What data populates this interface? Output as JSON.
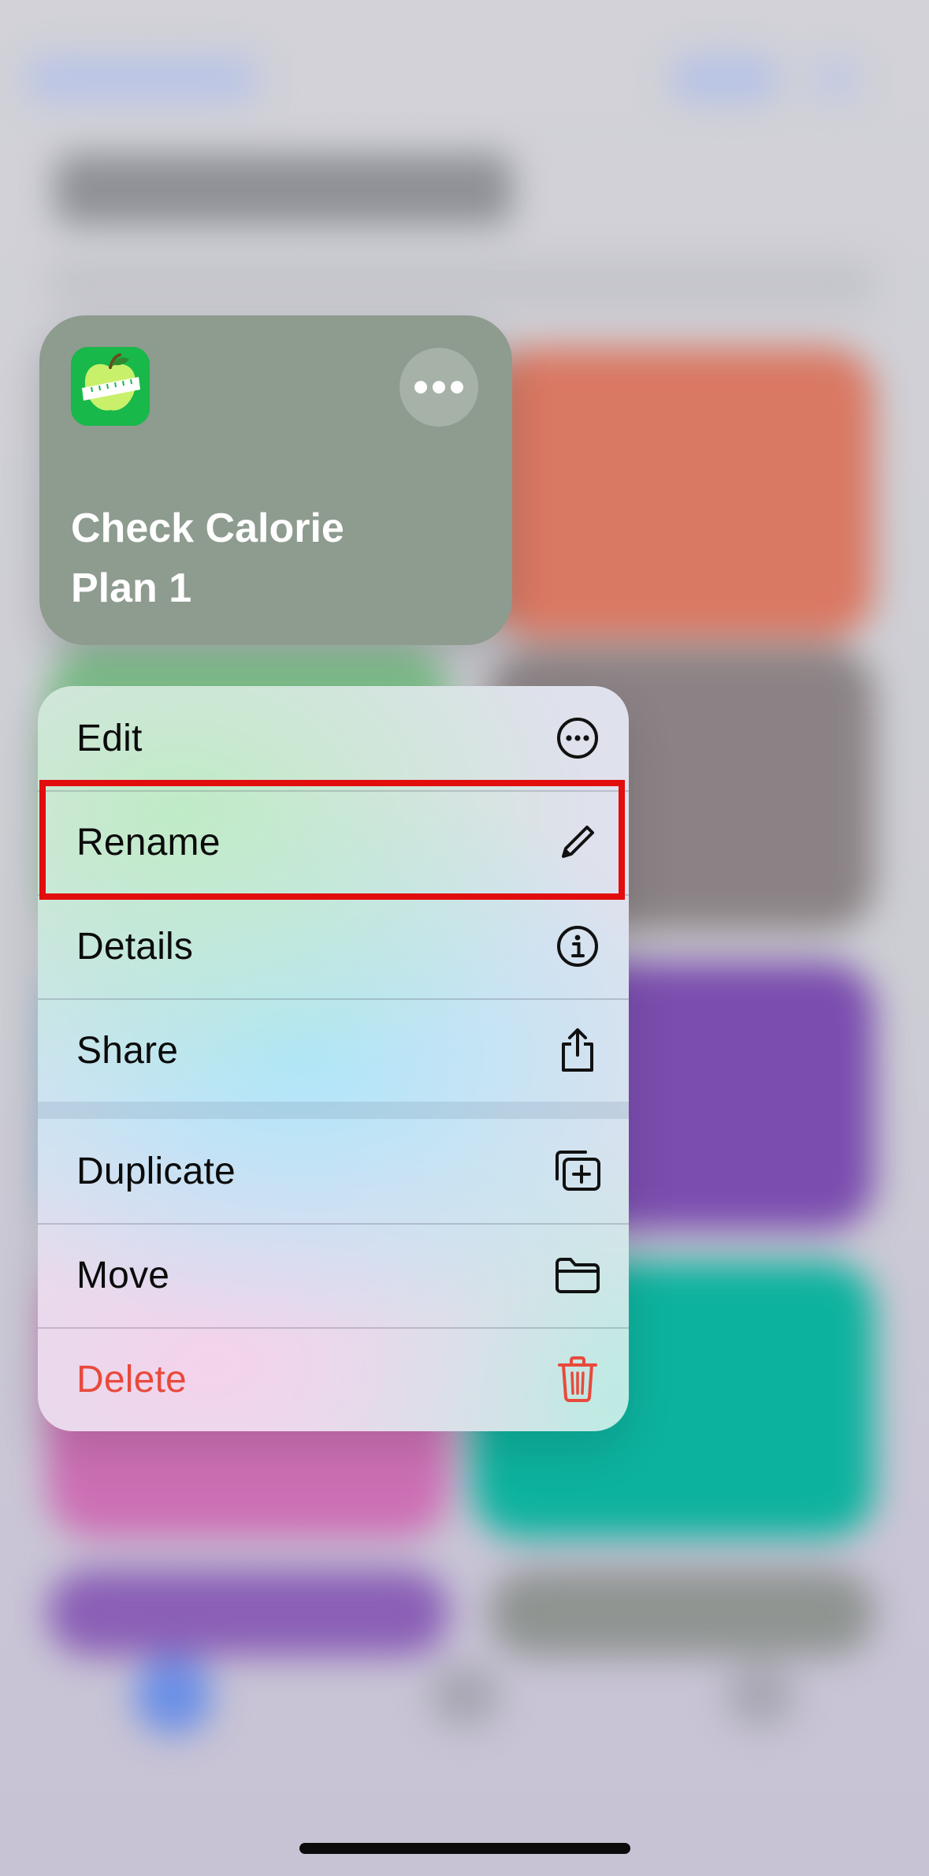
{
  "shortcut": {
    "title_line1": "Check Calorie",
    "title_line2": "Plan 1",
    "icon": "apple-tape-measure-icon",
    "card_color": "#8e9b8f",
    "more_icon": "ellipsis-icon"
  },
  "menu": {
    "items": [
      {
        "label": "Edit",
        "icon": "ellipsis-circle-icon"
      },
      {
        "label": "Rename",
        "icon": "pencil-icon",
        "highlighted": true
      },
      {
        "label": "Details",
        "icon": "info-circle-icon"
      },
      {
        "label": "Share",
        "icon": "share-icon"
      },
      {
        "label": "Duplicate",
        "icon": "duplicate-icon"
      },
      {
        "label": "Move",
        "icon": "folder-icon"
      },
      {
        "label": "Delete",
        "icon": "trash-icon",
        "destructive": true
      }
    ]
  },
  "colors": {
    "destructive": "#e84a3c",
    "highlight_border": "#e20d0d"
  }
}
